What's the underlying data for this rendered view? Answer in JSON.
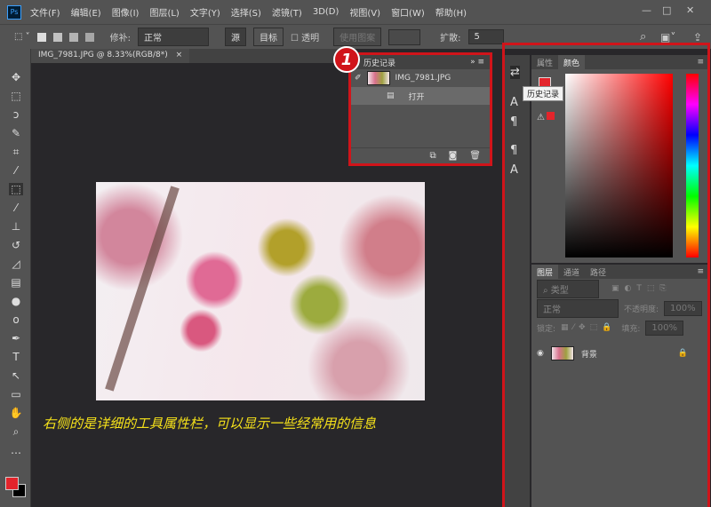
{
  "app": {
    "logo": "Ps"
  },
  "menu": [
    "文件(F)",
    "编辑(E)",
    "图像(I)",
    "图层(L)",
    "文字(Y)",
    "选择(S)",
    "滤镜(T)",
    "3D(D)",
    "视图(V)",
    "窗口(W)",
    "帮助(H)"
  ],
  "window_controls": {
    "minimize": "—",
    "maximize": "□",
    "close": "✕"
  },
  "options": {
    "patch_label": "修补:",
    "patch_mode": "正常",
    "source": "源",
    "target": "目标",
    "transparent": "透明",
    "use_pattern": "使用图案",
    "diffuse_label": "扩散:",
    "diffuse_value": "5"
  },
  "document": {
    "tab": "IMG_7981.JPG @ 8.33%(RGB/8*)",
    "close": "×"
  },
  "caption": "右侧的是详细的工具属性栏，可以显示一些经常用的信息",
  "badge": "1",
  "history": {
    "title": "历史记录",
    "snapshot": "IMG_7981.JPG",
    "steps": [
      "打开"
    ]
  },
  "tooltip": "历史记录",
  "color_panel": {
    "tabs": [
      "属性",
      "颜色"
    ],
    "accent": "#e3242b"
  },
  "layers": {
    "tabs": [
      "图层",
      "通道",
      "路径"
    ],
    "filter": "类型",
    "blend": "正常",
    "opacity_label": "不透明度:",
    "opacity": "100%",
    "lock_label": "锁定:",
    "fill_label": "填充:",
    "fill": "100%",
    "items": [
      {
        "name": "背景"
      }
    ]
  }
}
